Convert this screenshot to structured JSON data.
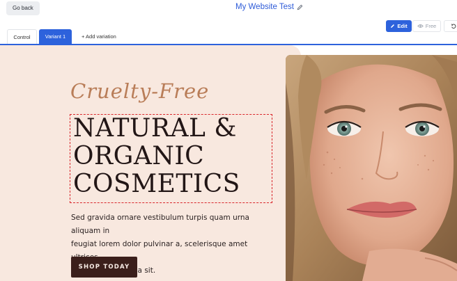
{
  "topbar": {
    "go_back_label": "Go back",
    "site_title": "My Website Test",
    "edit_label": "Edit",
    "free_label": "Free"
  },
  "tabs": [
    {
      "label": "Control",
      "active": false
    },
    {
      "label": "Variant 1",
      "active": true
    },
    {
      "label": "+ Add variation",
      "active": false
    }
  ],
  "hero": {
    "script_title": "Cruelty-Free",
    "headline_lines": [
      "NATURAL &",
      "ORGANIC",
      "COSMETICS"
    ],
    "body_lines": [
      "Sed gravida ornare vestibulum turpis quam urna aliquam in",
      "feugiat lorem dolor pulvinar a, scelerisque amet ultrices",
      "consectetur magna sit."
    ],
    "cta_label": "SHOP TODAY"
  },
  "colors": {
    "accent": "#2d62dc",
    "hero_background": "#f8e8df",
    "script_color": "#b97d58",
    "cta_background": "#3b1f1b",
    "selection_outline": "#d9262b"
  },
  "icons": {
    "title_edit": "pencil-icon",
    "edit_button": "pencil-icon",
    "preview_button": "eye-icon",
    "history_button": "undo-icon"
  }
}
